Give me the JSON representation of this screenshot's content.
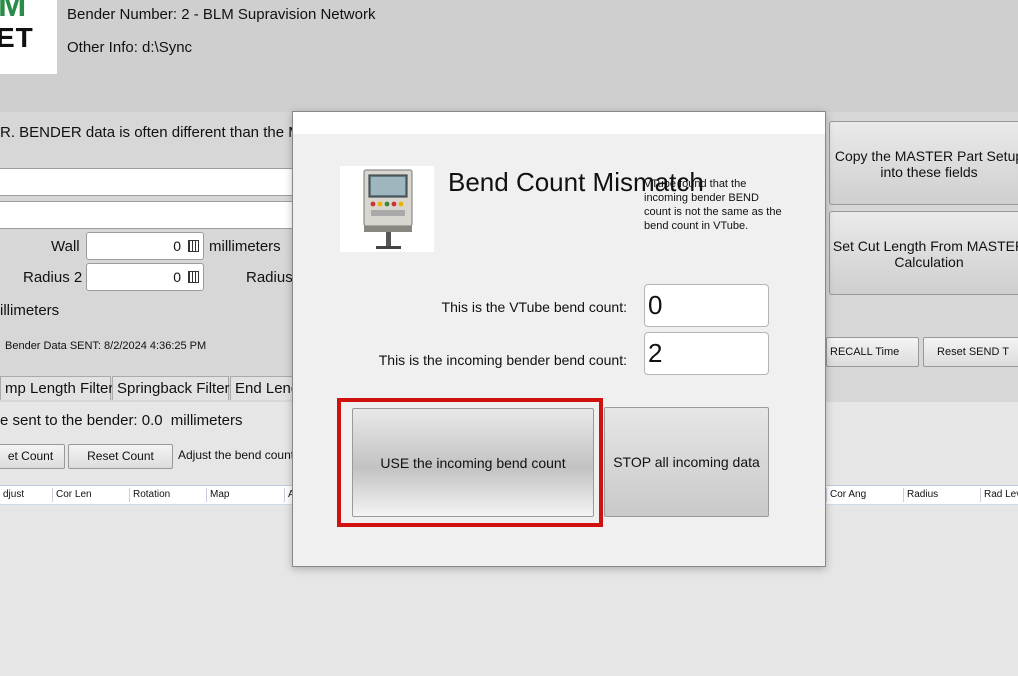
{
  "header": {
    "logo_top": "M",
    "logo_bottom": "ET",
    "bender_number": "Bender Number: 2 - BLM Supravision Network",
    "other_info": "Other Info: d:\\Sync"
  },
  "background": {
    "note_text": "R.  BENDER data is often different than the MA",
    "wall_label": "Wall",
    "wall_value": "0",
    "wall_unit": "millimeters",
    "radius2_label": "Radius 2",
    "radius2_value": "0",
    "radius_label": "Radius",
    "units_text": "illimeters",
    "sent_text": "Bender Data SENT:  8/2/2024 4:36:25 PM",
    "copy_button": "Copy the MASTER Part Setup into these fields",
    "cut_length_button": "Set Cut Length From MASTER Calculation",
    "recall_time_button": "RECALL Time",
    "reset_send_button": "Reset SEND T",
    "tabs": [
      "mp Length Filter",
      "Springback Filter",
      "End Leng"
    ],
    "sent_value_text": "e sent to the bender: 0.0",
    "sent_value_unit": "millimeters",
    "set_count_button": "et Count",
    "reset_count_button": "Reset Count",
    "adjust_text": "Adjust the bend count",
    "columns_left": [
      "djust",
      "Cor Len",
      "Rotation",
      "Map",
      "A"
    ],
    "columns_right": [
      "Cor Ang",
      "Radius",
      "Rad Lev"
    ]
  },
  "dialog": {
    "title": "Bend Count Mismatch",
    "info": "VTube found that the incoming bender BEND count is not the same as the bend count in VTube.",
    "vtube_prompt": "This is the VTube bend count:",
    "vtube_count": "0",
    "incoming_prompt": "This is the incoming bender bend count:",
    "incoming_count": "2",
    "use_button": "USE the incoming bend count",
    "stop_button": "STOP all incoming data",
    "icon": "bender-machine-icon"
  },
  "colors": {
    "highlight": "#d11010",
    "logo_green": "#2a8c4a"
  }
}
